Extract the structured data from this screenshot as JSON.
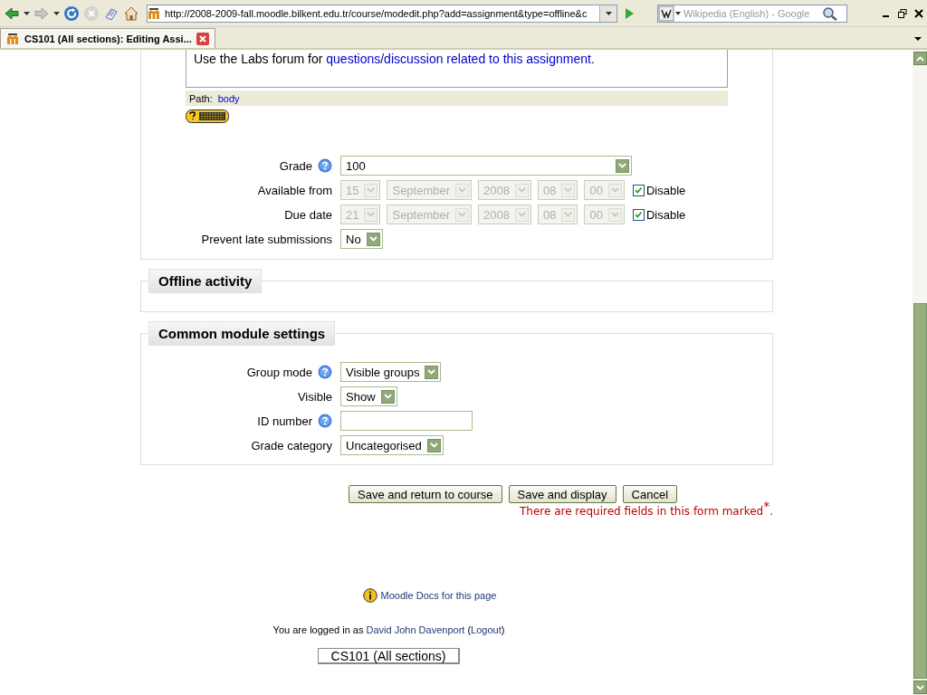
{
  "browser": {
    "url": "http://2008-2009-fall.moodle.bilkent.edu.tr/course/modedit.php?add=assignment&type=offline&c",
    "search_placeholder": "Wikipedia (English) - Google",
    "tabs": [
      {
        "title": "CS101 (All sections): Editing Assi...",
        "selected": true
      }
    ]
  },
  "editor": {
    "text": "Use the Labs forum for ",
    "link": "questions/discussion related to this assignment",
    "text_end": ".",
    "path_label": "Path:",
    "path_value": "body"
  },
  "assignment_fields": [
    {
      "kind": "select",
      "label": "Grade",
      "help": true,
      "value": "100",
      "full_width": true
    },
    {
      "kind": "date",
      "label": "Available from",
      "help": false,
      "parts": [
        "15",
        "September",
        "2008",
        "08",
        "00"
      ],
      "disable_label": "Disable",
      "checked": true
    },
    {
      "kind": "date",
      "label": "Due date",
      "help": false,
      "parts": [
        "21",
        "September",
        "2008",
        "08",
        "00"
      ],
      "disable_label": "Disable",
      "checked": true
    },
    {
      "kind": "select",
      "label": "Prevent late submissions",
      "help": false,
      "value": "No",
      "full_width": false
    }
  ],
  "sections": [
    {
      "legend": "Offline activity"
    },
    {
      "legend": "Common module settings",
      "fields": [
        {
          "kind": "select",
          "label": "Group mode",
          "help": true,
          "value": "Visible groups",
          "full_width": false
        },
        {
          "kind": "select",
          "label": "Visible",
          "help": false,
          "value": "Show",
          "full_width": false
        },
        {
          "kind": "text",
          "label": "ID number",
          "help": true
        },
        {
          "kind": "select",
          "label": "Grade category",
          "help": false,
          "value": "Uncategorised",
          "full_width": false
        }
      ]
    }
  ],
  "buttons": [
    "Save and return to course",
    "Save and display",
    "Cancel"
  ],
  "required_note": "There are required fields in this form marked$^{*}$.",
  "footer": {
    "docs_link": "Moodle Docs for this page",
    "login_text": "You are logged in as ",
    "user_link": "David John Davenport",
    "logout_open": " (",
    "logout_link": "Logout",
    "logout_close": ")",
    "course_button": "CS101 (All sections)"
  }
}
